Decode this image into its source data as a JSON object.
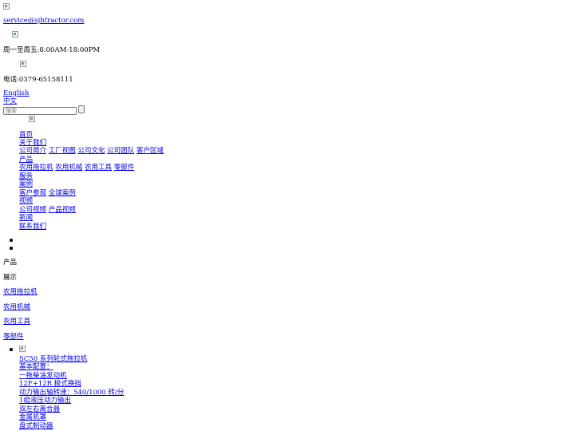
{
  "contact": {
    "email": "service@sjhtractor.com",
    "hours": "周一至周五:8:00AM-18:00PM",
    "phone": "电话:0379-65158111"
  },
  "language": {
    "english": "English",
    "chinese": "中文"
  },
  "search": {
    "placeholder": "搜索"
  },
  "nav": {
    "home": "首页",
    "about": "关于我们",
    "about_sub": [
      "公司简介",
      "工厂视图",
      "公司文化",
      "公司团队",
      "客户区域"
    ],
    "products": "产品",
    "products_sub": [
      "农用拖拉机",
      "农用机械",
      "农用工具",
      "零部件"
    ],
    "service": "服务",
    "cases": "案例",
    "cases_sub": [
      "客户参观",
      "全球案例"
    ],
    "video": "视频",
    "video_sub": [
      "公司视频",
      "产品视频"
    ],
    "news": "新闻",
    "contact": "联系我们"
  },
  "product_section": {
    "title_line1": "产品",
    "title_line2": "展示",
    "categories": [
      "农用拖拉机",
      "农用机械",
      "农用工具",
      "零部件"
    ]
  },
  "product_item": {
    "name": "SC50 系列轮式拖拉机",
    "specs": [
      "基本配置：",
      "一拖柴油发动机",
      "12F+12R 梭式换挡",
      "动力输出轴转速：540/1000 转/分",
      "1组液压动力输出",
      "双左右离合器",
      "金属机罩",
      "盘式制动器"
    ]
  }
}
